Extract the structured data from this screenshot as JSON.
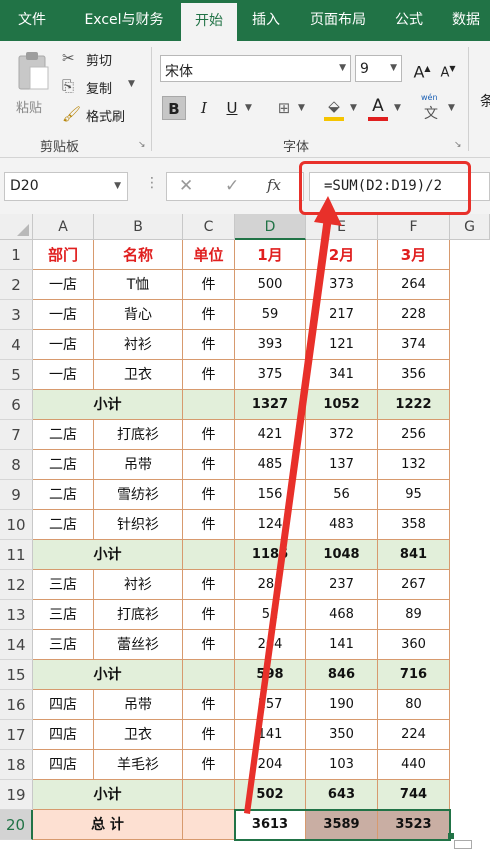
{
  "ribbon_tabs": [
    "文件",
    "Excel与财务",
    "开始",
    "插入",
    "页面布局",
    "公式",
    "数据"
  ],
  "active_tab": "开始",
  "clipboard": {
    "paste_label": "粘贴",
    "cut_label": "剪切",
    "copy_label": "复制",
    "format_painter_label": "格式刷",
    "group_label": "剪贴板"
  },
  "font": {
    "family": "宋体",
    "size": "9",
    "group_label": "字体",
    "bold": "B",
    "italic": "I",
    "underline": "U",
    "font_color": "A",
    "phonetic": "文",
    "phonetic_top": "wén",
    "grow": "A",
    "shrink": "A"
  },
  "next_group_partial": "条",
  "formula_bar": {
    "name_box": "D20",
    "fx": "fx",
    "formula": "=SUM(D2:D19)/2"
  },
  "columns": [
    "A",
    "B",
    "C",
    "D",
    "E",
    "F",
    "G"
  ],
  "rows": [
    {
      "n": "1",
      "type": "header",
      "cells": [
        "部门",
        "名称",
        "单位",
        "1月",
        "2月",
        "3月"
      ]
    },
    {
      "n": "2",
      "type": "data",
      "cells": [
        "一店",
        "T恤",
        "件",
        "500",
        "373",
        "264"
      ]
    },
    {
      "n": "3",
      "type": "data",
      "cells": [
        "一店",
        "背心",
        "件",
        "59",
        "217",
        "228"
      ]
    },
    {
      "n": "4",
      "type": "data",
      "cells": [
        "一店",
        "衬衫",
        "件",
        "393",
        "121",
        "374"
      ]
    },
    {
      "n": "5",
      "type": "data",
      "cells": [
        "一店",
        "卫衣",
        "件",
        "375",
        "341",
        "356"
      ]
    },
    {
      "n": "6",
      "type": "subtotal",
      "cells": [
        "小计",
        "",
        "",
        "1327",
        "1052",
        "1222"
      ]
    },
    {
      "n": "7",
      "type": "data",
      "cells": [
        "二店",
        "打底衫",
        "件",
        "421",
        "372",
        "256"
      ]
    },
    {
      "n": "8",
      "type": "data",
      "cells": [
        "二店",
        "吊带",
        "件",
        "485",
        "137",
        "132"
      ]
    },
    {
      "n": "9",
      "type": "data",
      "cells": [
        "二店",
        "雪纺衫",
        "件",
        "156",
        "56",
        "95"
      ]
    },
    {
      "n": "10",
      "type": "data",
      "cells": [
        "二店",
        "针织衫",
        "件",
        "124",
        "483",
        "358"
      ]
    },
    {
      "n": "11",
      "type": "subtotal",
      "cells": [
        "小计",
        "",
        "",
        "1186",
        "1048",
        "841"
      ]
    },
    {
      "n": "12",
      "type": "data",
      "cells": [
        "三店",
        "衬衫",
        "件",
        "283",
        "237",
        "267"
      ]
    },
    {
      "n": "13",
      "type": "data",
      "cells": [
        "三店",
        "打底衫",
        "件",
        "51",
        "468",
        "89"
      ]
    },
    {
      "n": "14",
      "type": "data",
      "cells": [
        "三店",
        "蕾丝衫",
        "件",
        "264",
        "141",
        "360"
      ]
    },
    {
      "n": "15",
      "type": "subtotal",
      "cells": [
        "小计",
        "",
        "",
        "598",
        "846",
        "716"
      ]
    },
    {
      "n": "16",
      "type": "data",
      "cells": [
        "四店",
        "吊带",
        "件",
        "157",
        "190",
        "80"
      ]
    },
    {
      "n": "17",
      "type": "data",
      "cells": [
        "四店",
        "卫衣",
        "件",
        "141",
        "350",
        "224"
      ]
    },
    {
      "n": "18",
      "type": "data",
      "cells": [
        "四店",
        "羊毛衫",
        "件",
        "204",
        "103",
        "440"
      ]
    },
    {
      "n": "19",
      "type": "subtotal",
      "cells": [
        "小计",
        "",
        "",
        "502",
        "643",
        "744"
      ]
    },
    {
      "n": "20",
      "type": "total",
      "cells": [
        "总    计",
        "",
        "",
        "3613",
        "3589",
        "3523"
      ]
    }
  ],
  "selected_cell": "D20",
  "colors": {
    "excel_green": "#217346",
    "header_text": "#e01f1f",
    "subtotal_fill": "#e2efda",
    "total_fill": "#fde0d2",
    "total_dark_fill": "#c9aea3",
    "cell_border": "#d79a6e",
    "annotation_red": "#e8302a"
  }
}
